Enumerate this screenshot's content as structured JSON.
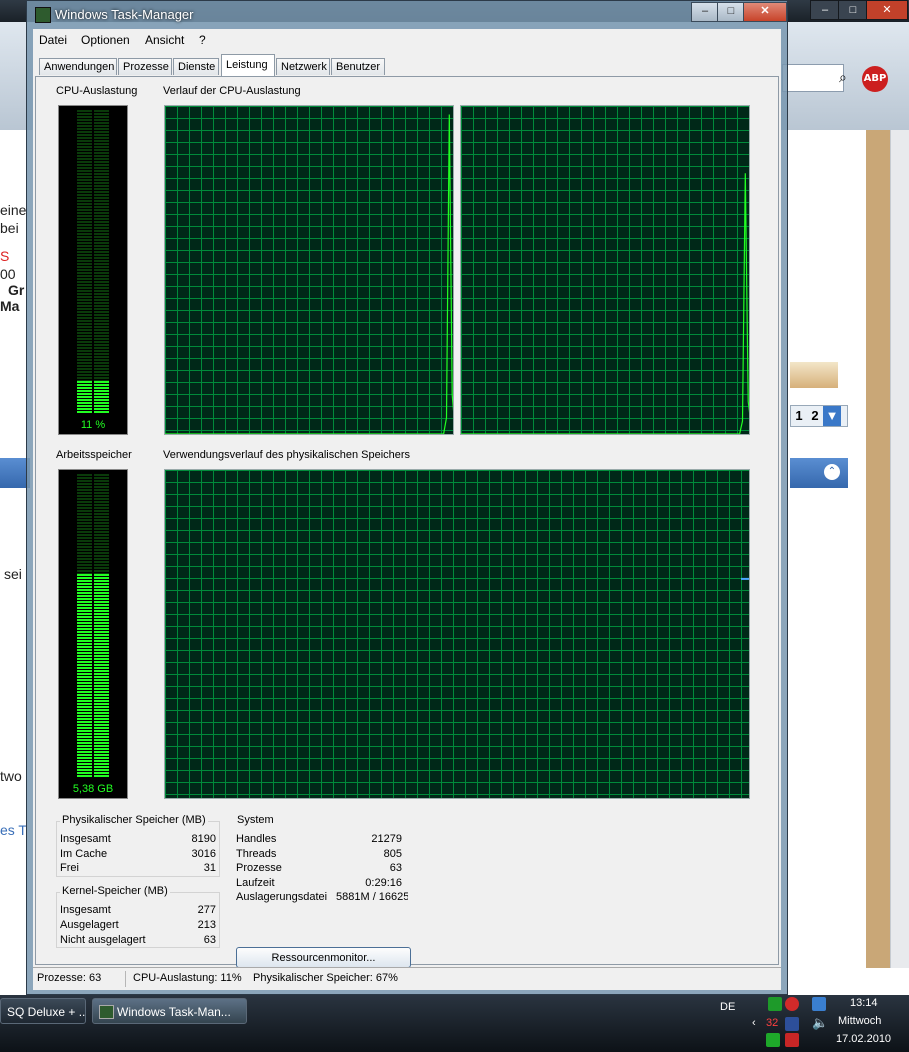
{
  "window": {
    "title": "Windows Task-Manager",
    "controls": {
      "minimize": "–",
      "maximize": "□",
      "close": "✕"
    }
  },
  "menu": [
    "Datei",
    "Optionen",
    "Ansicht",
    "?"
  ],
  "tabs": [
    {
      "label": "Anwendungen",
      "active": false
    },
    {
      "label": "Prozesse",
      "active": false
    },
    {
      "label": "Dienste",
      "active": false
    },
    {
      "label": "Leistung",
      "active": true
    },
    {
      "label": "Netzwerk",
      "active": false
    },
    {
      "label": "Benutzer",
      "active": false
    }
  ],
  "cpu": {
    "meter_label": "CPU-Auslastung",
    "value_text": "11 %",
    "usage_fraction": 0.11,
    "history_label": "Verlauf der CPU-Auslastung",
    "history_cores": [
      [
        0,
        0,
        0,
        0,
        0,
        0,
        0,
        0,
        0,
        0,
        0,
        0,
        0,
        0,
        0,
        0,
        0,
        0,
        0,
        0,
        0,
        0,
        0,
        0,
        0,
        0,
        0,
        0,
        0,
        0,
        0,
        0,
        0,
        0,
        0,
        0,
        0,
        0,
        0,
        0,
        0,
        0,
        0,
        0,
        0,
        0,
        0,
        0,
        0,
        0,
        0,
        0,
        0,
        0,
        0,
        0,
        0,
        0,
        0,
        0,
        0,
        0,
        0,
        0,
        0,
        0,
        0,
        0,
        0,
        0,
        0,
        0,
        0,
        0,
        0,
        0,
        0,
        0,
        0,
        0,
        0,
        0,
        0,
        0,
        0,
        0,
        0,
        0,
        0,
        0,
        0,
        0,
        0,
        0,
        0,
        0,
        0,
        0,
        0,
        0.05,
        0.98,
        0.12,
        0.02
      ],
      [
        0,
        0,
        0,
        0,
        0,
        0,
        0,
        0,
        0,
        0,
        0,
        0,
        0,
        0,
        0,
        0,
        0,
        0,
        0,
        0,
        0,
        0,
        0,
        0,
        0,
        0,
        0,
        0,
        0,
        0,
        0,
        0,
        0,
        0,
        0,
        0,
        0,
        0,
        0,
        0,
        0,
        0,
        0,
        0,
        0,
        0,
        0,
        0,
        0,
        0,
        0,
        0,
        0,
        0,
        0,
        0,
        0,
        0,
        0,
        0,
        0,
        0,
        0,
        0,
        0,
        0,
        0,
        0,
        0,
        0,
        0,
        0,
        0,
        0,
        0,
        0,
        0,
        0,
        0,
        0,
        0,
        0,
        0,
        0,
        0,
        0,
        0,
        0,
        0,
        0,
        0,
        0,
        0,
        0,
        0,
        0,
        0,
        0,
        0,
        0.04,
        0.8,
        0.1,
        0.03
      ]
    ]
  },
  "memory": {
    "meter_label": "Arbeitsspeicher",
    "value_text": "5,38 GB",
    "usage_fraction": 0.67,
    "history_label": "Verwendungsverlauf des physikalischen Speichers",
    "history_level": 0.67
  },
  "physical_memory": {
    "title": "Physikalischer Speicher (MB)",
    "rows": [
      {
        "label": "Insgesamt",
        "value": "8190"
      },
      {
        "label": "Im Cache",
        "value": "3016"
      },
      {
        "label": "Frei",
        "value": "31"
      }
    ]
  },
  "kernel_memory": {
    "title": "Kernel-Speicher (MB)",
    "rows": [
      {
        "label": "Insgesamt",
        "value": "277"
      },
      {
        "label": "Ausgelagert",
        "value": "213"
      },
      {
        "label": "Nicht ausgelagert",
        "value": "63"
      }
    ]
  },
  "system": {
    "title": "System",
    "rows": [
      {
        "label": "Handles",
        "value": "21279"
      },
      {
        "label": "Threads",
        "value": "805"
      },
      {
        "label": "Prozesse",
        "value": "63"
      },
      {
        "label": "Laufzeit",
        "value": "0:29:16"
      },
      {
        "label": "Auslagerungsdatei",
        "value": "5881M / 16625M"
      }
    ]
  },
  "resource_monitor_button": "Ressourcenmonitor...",
  "statusbar": {
    "processes": "Prozesse: 63",
    "cpu": "CPU-Auslastung: 11%",
    "memory": "Physikalischer Speicher: 67%"
  },
  "background_window": {
    "abp_label": "ABP",
    "text_fragments": [
      "eine",
      "bei",
      "S",
      "00",
      "Gr",
      "Ma",
      "sei",
      "two",
      "es T"
    ],
    "pager": [
      "1",
      "2"
    ]
  },
  "taskbar": {
    "items": [
      {
        "label": "SQ Deluxe + ..."
      },
      {
        "label": "Windows Task-Man..."
      }
    ],
    "language": "DE",
    "tray_number": "32",
    "time": "13:14",
    "weekday": "Mittwoch",
    "date": "17.02.2010"
  },
  "colors": {
    "meter_green": "#22ff22",
    "grid_green": "#008a3a",
    "graph_bg": "#002818"
  }
}
